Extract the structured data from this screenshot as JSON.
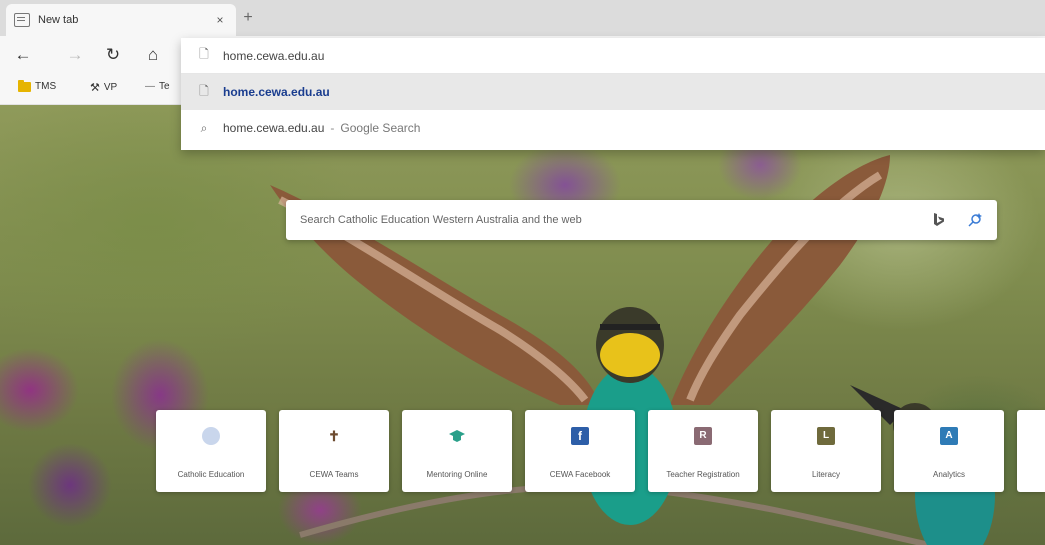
{
  "tab": {
    "title": "New tab",
    "close": "×",
    "new_tab": "+"
  },
  "toolbar": {
    "back": "←",
    "forward": "→",
    "refresh": "↻",
    "home": "⌂"
  },
  "favorites": [
    {
      "label": "TMS",
      "icon": "folder-icon"
    },
    {
      "label": "VP",
      "icon": "tools-icon"
    },
    {
      "label": "Te",
      "icon": "link-icon"
    }
  ],
  "omnibox": {
    "input_value": "home.cewa.edu.au",
    "suggestion_url": "home.cewa.edu.au",
    "search_query": "home.cewa.edu.au",
    "search_engine": "Google Search",
    "separator": "-"
  },
  "page_search": {
    "placeholder": "Search Catholic Education Western Australia and the web"
  },
  "quick_links": [
    {
      "label": "Catholic Education",
      "icon": "globe-icon",
      "letter": "",
      "color": "#c9d6ec"
    },
    {
      "label": "CEWA Teams",
      "icon": "cross-icon",
      "letter": "✝",
      "color": "#6d4b2f"
    },
    {
      "label": "Mentoring Online",
      "icon": "graduation-cap-icon",
      "letter": "🎓",
      "color": "#2aa08a"
    },
    {
      "label": "CEWA Facebook",
      "icon": "facebook-icon",
      "letter": "f",
      "color": "#2d5ea8"
    },
    {
      "label": "Teacher Registration",
      "icon": "letter-r-icon",
      "letter": "R",
      "color": "#8a6a73"
    },
    {
      "label": "Literacy",
      "icon": "letter-l-icon",
      "letter": "L",
      "color": "#6f6a3c"
    },
    {
      "label": "Analytics",
      "icon": "letter-a-icon",
      "letter": "A",
      "color": "#2e7bb6"
    }
  ]
}
